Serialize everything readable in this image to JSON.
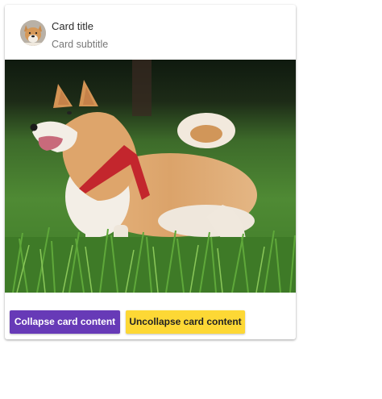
{
  "card": {
    "title": "Card title",
    "subtitle": "Card subtitle",
    "avatar_image": "shiba-inu-dog-avatar",
    "media_image": "shiba-inu-dog-standing-in-grass"
  },
  "actions": {
    "collapse_label": "Collapse card content",
    "uncollapse_label": "Uncollapse card content"
  },
  "colors": {
    "collapse_button": "#673ab7",
    "uncollapse_button": "#fdd835"
  }
}
